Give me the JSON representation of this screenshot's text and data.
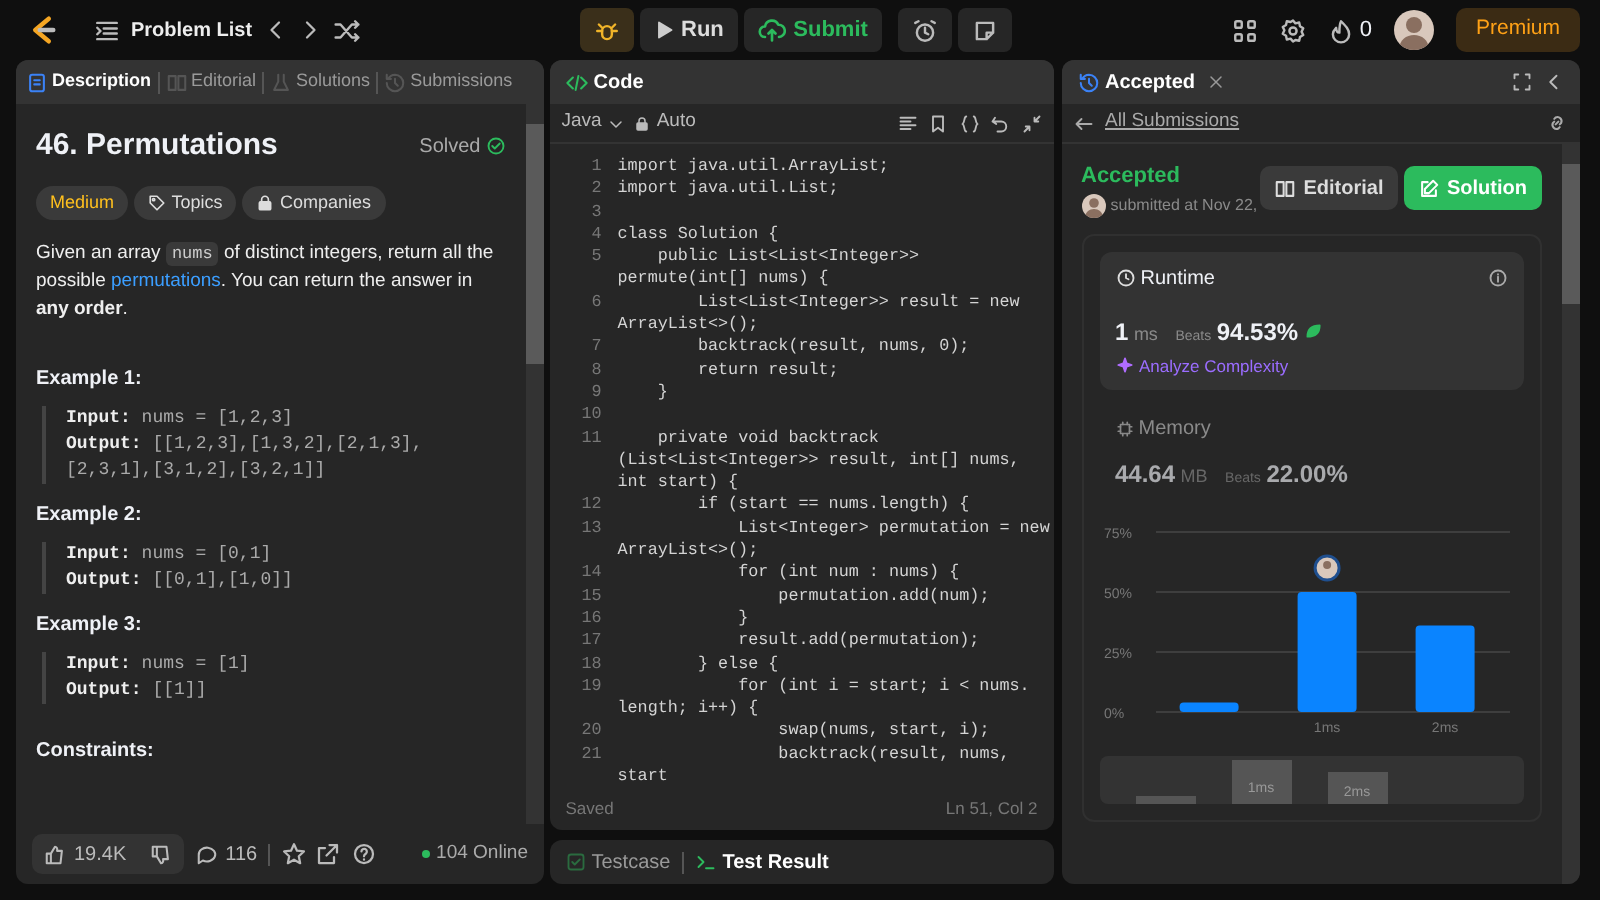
{
  "topbar": {
    "problem_list": "Problem List",
    "run": "Run",
    "submit": "Submit",
    "streak": "0",
    "premium": "Premium"
  },
  "left_panel": {
    "tabs": [
      {
        "label": "Description",
        "kind": "description",
        "selected": true
      },
      {
        "label": "Editorial",
        "kind": "editorial",
        "selected": false
      },
      {
        "label": "Solutions",
        "kind": "solutions",
        "selected": false
      },
      {
        "label": "Submissions",
        "kind": "submissions",
        "selected": false
      }
    ],
    "title": "46. Permutations",
    "status": "Solved",
    "tags": [
      {
        "label": "Medium",
        "kind": "difficulty"
      },
      {
        "label": "Topics",
        "kind": "topics"
      },
      {
        "label": "Companies",
        "kind": "companies"
      }
    ],
    "description": [
      {
        "kind": "text",
        "text": "Given an array "
      },
      {
        "kind": "code",
        "text": "nums"
      },
      {
        "kind": "text",
        "text": " of distinct integers, return all the possible "
      },
      {
        "kind": "link",
        "text": "permutations"
      },
      {
        "kind": "text",
        "text": ". You can return the answer in **any order**."
      }
    ],
    "examples": [
      {
        "title": "Example 1:",
        "lines": [
          "**Input:** nums = [1,2,3]",
          "**Output:** [[1,2,3],[1,3,2],[2,1,3],[2,3,1],[3,1,2],[3,2,1]]"
        ]
      },
      {
        "title": "Example 2:",
        "lines": [
          "**Input:** nums = [0,1]",
          "**Output:** [[0,1],[1,0]]"
        ]
      },
      {
        "title": "Example 3:",
        "lines": [
          "**Input:** nums = [1]",
          "**Output:** [[1]]"
        ]
      }
    ],
    "constraints": "Constraints:",
    "footer": {
      "likes": "19.4K",
      "comments": "116",
      "online": "104 Online"
    }
  },
  "code_panel": {
    "title": "Code",
    "language": "Java",
    "mode": "Auto",
    "lines": [
      {
        "n": "1",
        "text": "import java.util.ArrayList;"
      },
      {
        "n": "2",
        "text": "import java.util.List;"
      },
      {
        "n": "3"
      },
      {
        "n": "4",
        "text": "class Solution {"
      },
      {
        "n": "5",
        "text": "    public List<List<Integer>> permute(int[] nums) {"
      },
      {
        "n": "6",
        "text": "        List<List<Integer>> result = new ArrayList<>();"
      },
      {
        "n": "7",
        "text": "        backtrack(result, nums, 0);"
      },
      {
        "n": "8",
        "text": "        return result;"
      },
      {
        "n": "9",
        "text": "    }"
      },
      {
        "n": "10"
      },
      {
        "n": "11",
        "text": "    private void backtrack (List<List<Integer>> result, int[] nums, int start) {"
      },
      {
        "n": "12",
        "text": "        if (start == nums.length) {"
      },
      {
        "n": "13",
        "text": "            List<Integer> permutation = new ArrayList<>();"
      },
      {
        "n": "14",
        "text": "            for (int num : nums) {"
      },
      {
        "n": "15",
        "text": "                permutation.add(num);"
      },
      {
        "n": "16",
        "text": "            }"
      },
      {
        "n": "17",
        "text": "            result.add(permutation);"
      },
      {
        "n": "18",
        "text": "        } else {"
      },
      {
        "n": "19",
        "text": "            for (int i = start; i < nums. length; i++) {"
      },
      {
        "n": "20",
        "text": "                swap(nums, start, i);"
      },
      {
        "n": "21",
        "text": "                backtrack(result, nums, start"
      }
    ],
    "saved": "Saved",
    "cursor": "Ln 51, Col 2"
  },
  "bottom_tabs": [
    {
      "label": "Testcase",
      "selected": false
    },
    {
      "label": "Test Result",
      "selected": true
    }
  ],
  "result_panel": {
    "tab": "Accepted",
    "back": "All Submissions",
    "status": "Accepted",
    "submitted": "submitted at Nov 22,",
    "buttons": [
      {
        "label": "Editorial",
        "kind": "editorial"
      },
      {
        "label": "Solution",
        "kind": "solution"
      }
    ],
    "runtime": {
      "label": "Runtime",
      "value": "1",
      "unit": "ms",
      "beats_label": "Beats",
      "beats": "94.53%",
      "analyze": "Analyze Complexity"
    },
    "memory": {
      "label": "Memory",
      "value": "44.64",
      "unit": "MB",
      "beats_label": "Beats",
      "beats": "22.00%"
    },
    "chart_data": {
      "type": "bar",
      "categories": [
        null,
        "1ms",
        "2ms"
      ],
      "values": [
        4,
        50,
        36
      ],
      "ylim": [
        0,
        75
      ],
      "yticks": [
        {
          "value": 0,
          "label": "0%"
        },
        {
          "value": 25,
          "label": "25%"
        },
        {
          "value": 50,
          "label": "50%"
        },
        {
          "value": 75,
          "label": "75%"
        }
      ]
    },
    "overview": [
      "1ms",
      "2ms"
    ]
  }
}
